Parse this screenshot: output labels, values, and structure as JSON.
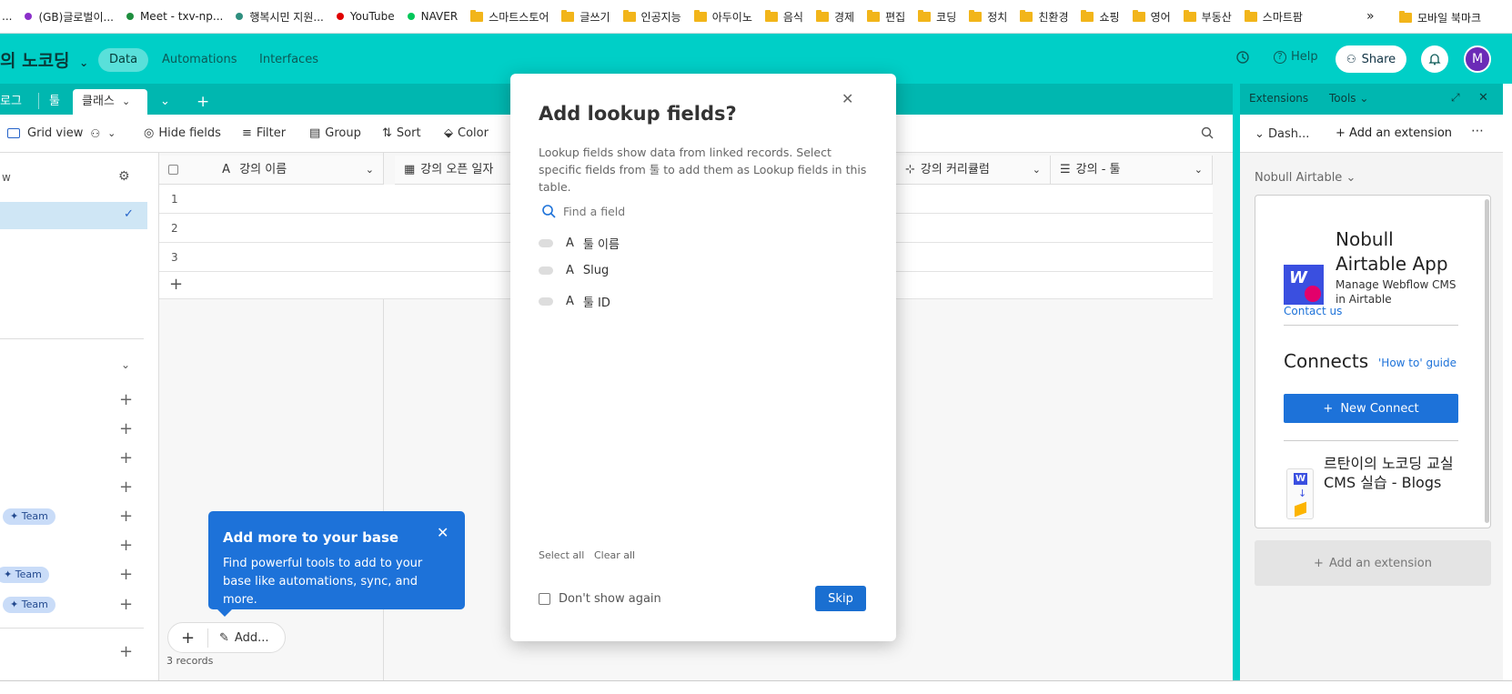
{
  "bookmarks": [
    {
      "label": "...",
      "type": "text"
    },
    {
      "label": "(GB)글로벌이...",
      "type": "dot",
      "color": "#8b2fc9"
    },
    {
      "label": "Meet - txv-np...",
      "type": "dot",
      "color": "#1e8e3e"
    },
    {
      "label": "행복시민 지원...",
      "type": "dot",
      "color": "#2f8f7f"
    },
    {
      "label": "YouTube",
      "type": "dot",
      "color": "#e00000"
    },
    {
      "label": "NAVER",
      "type": "dot",
      "color": "#03c75a"
    },
    {
      "label": "스마트스토어",
      "type": "folder"
    },
    {
      "label": "글쓰기",
      "type": "folder"
    },
    {
      "label": "인공지능",
      "type": "folder"
    },
    {
      "label": "아두이노",
      "type": "folder"
    },
    {
      "label": "음식",
      "type": "folder"
    },
    {
      "label": "경제",
      "type": "folder"
    },
    {
      "label": "편집",
      "type": "folder"
    },
    {
      "label": "코딩",
      "type": "folder"
    },
    {
      "label": "정치",
      "type": "folder"
    },
    {
      "label": "친환경",
      "type": "folder"
    },
    {
      "label": "쇼핑",
      "type": "folder"
    },
    {
      "label": "영어",
      "type": "folder"
    },
    {
      "label": "부동산",
      "type": "folder"
    },
    {
      "label": "스마트팜",
      "type": "folder"
    }
  ],
  "bookmarks_more": "»",
  "bookmarks_mobile": "모바일 북마크",
  "header": {
    "base_name": "의 노코딩",
    "nav": [
      "Data",
      "Automations",
      "Interfaces"
    ],
    "help": "Help",
    "share": "Share",
    "avatar": "M"
  },
  "tables": {
    "tabs": [
      "로그",
      "툴",
      "클래스"
    ],
    "add": "+"
  },
  "viewbar": {
    "grid_view": "Grid view",
    "hide_fields": "Hide fields",
    "filter": "Filter",
    "group": "Group",
    "sort": "Sort",
    "color": "Color"
  },
  "sidebar": {
    "find_label": "w",
    "team_badge": "Team"
  },
  "grid": {
    "columns": [
      "강의 이름",
      "강의 오픈 일자",
      "강의 커리큘럼",
      "강의 - 툴"
    ],
    "rows": [
      "1",
      "2",
      "3"
    ],
    "add_row": "+",
    "records_count": "3 records",
    "add_label": "Add..."
  },
  "extensions": {
    "tab_extensions": "Extensions",
    "tab_tools": "Tools",
    "dash": "Dash...",
    "add_extension": "Add an extension",
    "workspace": "Nobull Airtable",
    "app_title": "Nobull Airtable App",
    "app_desc": "Manage Webflow CMS in Airtable",
    "contact": "Contact us",
    "connects": "Connects",
    "howto": "'How to' guide",
    "new_connect": "New Connect",
    "connect_item": "르탄이의 노코딩 교실 CMS 실습 - Blogs",
    "add_extension_bottom": "Add an extension"
  },
  "modal": {
    "title": "Add lookup fields?",
    "description": "Lookup fields show data from linked records. Select specific fields from 툴 to add them as Lookup fields in this table.",
    "search_placeholder": "Find a field",
    "fields": [
      "툴 이름",
      "Slug",
      "툴 ID"
    ],
    "select_all": "Select all",
    "clear_all": "Clear all",
    "dont_show": "Don't show again",
    "skip": "Skip"
  },
  "tooltip": {
    "title": "Add more to your base",
    "body": "Find powerful tools to add to your base like automations, sync, and more."
  },
  "colors": {
    "accent": "#00cfc7",
    "primary_blue": "#1d72d9",
    "skip_button": "#1a6fd1"
  }
}
